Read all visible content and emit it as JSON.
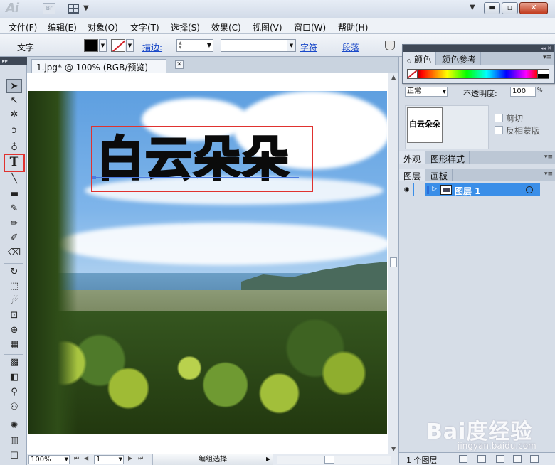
{
  "app": {
    "logo": "Ai",
    "bridge_label": "Br"
  },
  "window_buttons": {
    "minimize": "▬",
    "maximize": "▫",
    "close": "✕"
  },
  "menus": [
    "文件(F)",
    "编辑(E)",
    "对象(O)",
    "文字(T)",
    "选择(S)",
    "效果(C)",
    "视图(V)",
    "窗口(W)",
    "帮助(H)"
  ],
  "control_bar": {
    "tool_label": "文字",
    "fill_color": "#000000",
    "stroke_label": "描边:",
    "stroke_weight": "",
    "font_value": "",
    "char_link": "字符",
    "para_link": "段落"
  },
  "document": {
    "tab_title": "1.jpg* @ 100% (RGB/预览)",
    "close_glyph": "✕"
  },
  "artwork": {
    "text": "白云朵朵",
    "highlight_color": "#e0322f"
  },
  "status": {
    "zoom": "100%",
    "page": "1",
    "status_text": "编组选择"
  },
  "panels": {
    "color": {
      "tabs": [
        "颜色",
        "颜色参考"
      ]
    },
    "transparency": {
      "mode": "正常",
      "opacity_label": "不透明度:",
      "opacity_value": "100",
      "opacity_unit": "%"
    },
    "thumb_text": "白云朵朵",
    "clip_label": "剪切",
    "invert_label": "反相蒙版",
    "appearance_tabs": [
      "外观",
      "图形样式"
    ],
    "layers_tabs": [
      "图层",
      "画板"
    ],
    "layer_name": "图层 1",
    "layer_count": "1 个图层"
  },
  "icons": {
    "tools": [
      "selection-tool-icon",
      "direct-selection-tool-icon",
      "magic-wand-tool-icon",
      "lasso-tool-icon",
      "pen-tool-icon",
      "type-tool-icon",
      "line-tool-icon",
      "rectangle-tool-icon",
      "paintbrush-tool-icon",
      "pencil-tool-icon",
      "blob-brush-tool-icon",
      "eraser-tool-icon",
      "rotate-tool-icon",
      "scale-tool-icon",
      "warp-tool-icon",
      "free-transform-tool-icon",
      "shape-builder-tool-icon",
      "perspective-grid-tool-icon",
      "mesh-tool-icon",
      "gradient-tool-icon",
      "eyedropper-tool-icon",
      "blend-tool-icon",
      "symbol-sprayer-tool-icon",
      "column-graph-tool-icon"
    ]
  },
  "watermark": {
    "logo": "Bai度经验",
    "url": "jingyan.baidu.com"
  }
}
